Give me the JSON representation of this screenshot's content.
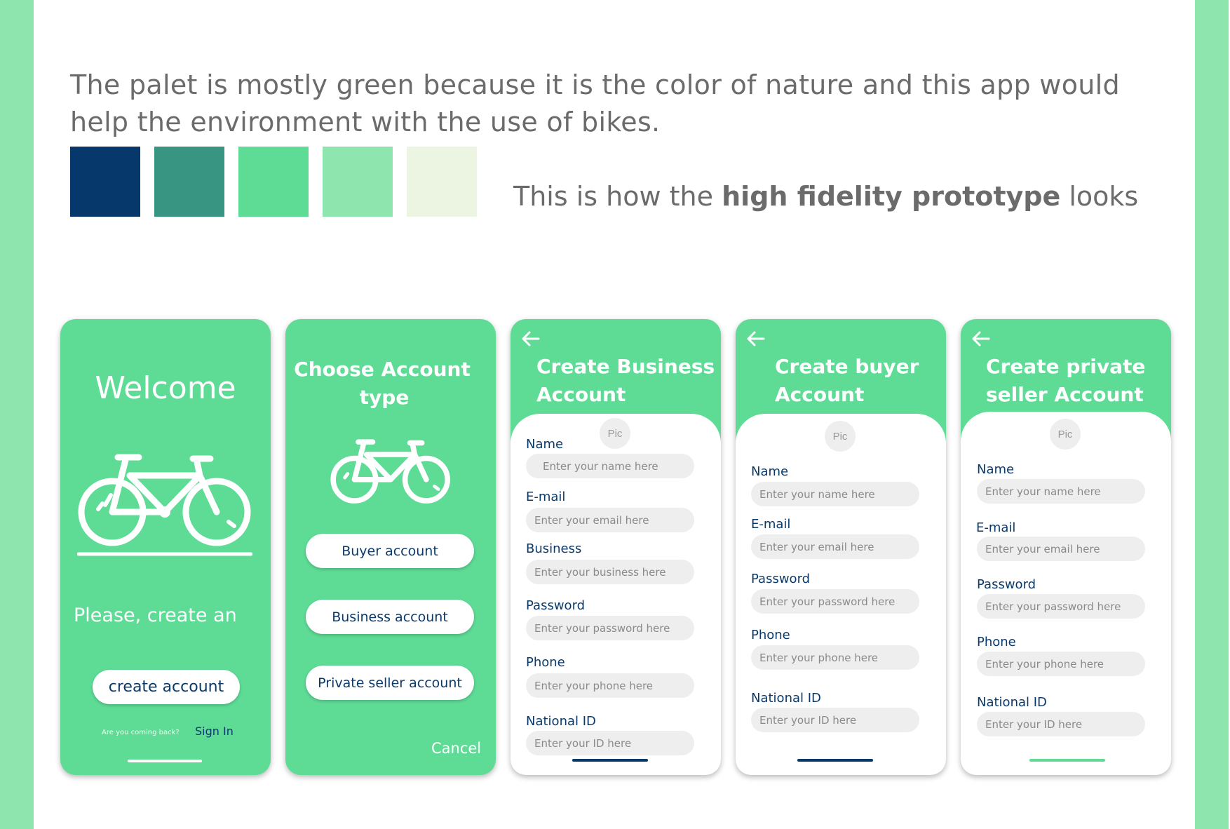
{
  "intro_text": "The palet is mostly green because it is the color of nature and this app would help the environment with the use of bikes.",
  "palette": [
    "#06386b",
    "#389581",
    "#5edc96",
    "#8ee5ad",
    "#ebf5e2"
  ],
  "hf_before": "This is how the ",
  "hf_bold": "high fidelity prototype",
  "hf_after": " looks",
  "welcome": {
    "title": "Welcome",
    "subtitle": "Please, create an",
    "create_button": "create account",
    "coming_back": "Are you coming back?",
    "sign_in": "Sign In"
  },
  "choose": {
    "title_line1": "Choose Account",
    "title_line2": "type",
    "buttons": [
      "Buyer account",
      "Business account",
      "Private seller account"
    ],
    "cancel": "Cancel"
  },
  "business_form": {
    "title_line1": "Create Business",
    "title_line2": "Account",
    "pic": "Pic",
    "fields": [
      {
        "label": "Name",
        "placeholder": "Enter your name here"
      },
      {
        "label": "E-mail",
        "placeholder": "Enter your email here"
      },
      {
        "label": "Business",
        "placeholder": "Enter your business here"
      },
      {
        "label": "Password",
        "placeholder": "Enter your password here"
      },
      {
        "label": "Phone",
        "placeholder": "Enter your phone here"
      },
      {
        "label": "National ID",
        "placeholder": "Enter your ID here"
      }
    ]
  },
  "buyer_form": {
    "title_line1": "Create buyer",
    "title_line2": "Account",
    "pic": "Pic",
    "fields": [
      {
        "label": "Name",
        "placeholder": "Enter your name here"
      },
      {
        "label": "E-mail",
        "placeholder": "Enter your email here"
      },
      {
        "label": "Password",
        "placeholder": "Enter your password here"
      },
      {
        "label": "Phone",
        "placeholder": "Enter your phone here"
      },
      {
        "label": "National ID",
        "placeholder": "Enter your ID here"
      }
    ]
  },
  "seller_form": {
    "title_line1": "Create private",
    "title_line2": "seller Account",
    "pic": "Pic",
    "fields": [
      {
        "label": "Name",
        "placeholder": "Enter your name here"
      },
      {
        "label": "E-mail",
        "placeholder": "Enter your email here"
      },
      {
        "label": "Password",
        "placeholder": "Enter your password here"
      },
      {
        "label": "Phone",
        "placeholder": "Enter your phone here"
      },
      {
        "label": "National ID",
        "placeholder": "Enter your ID here"
      }
    ]
  }
}
